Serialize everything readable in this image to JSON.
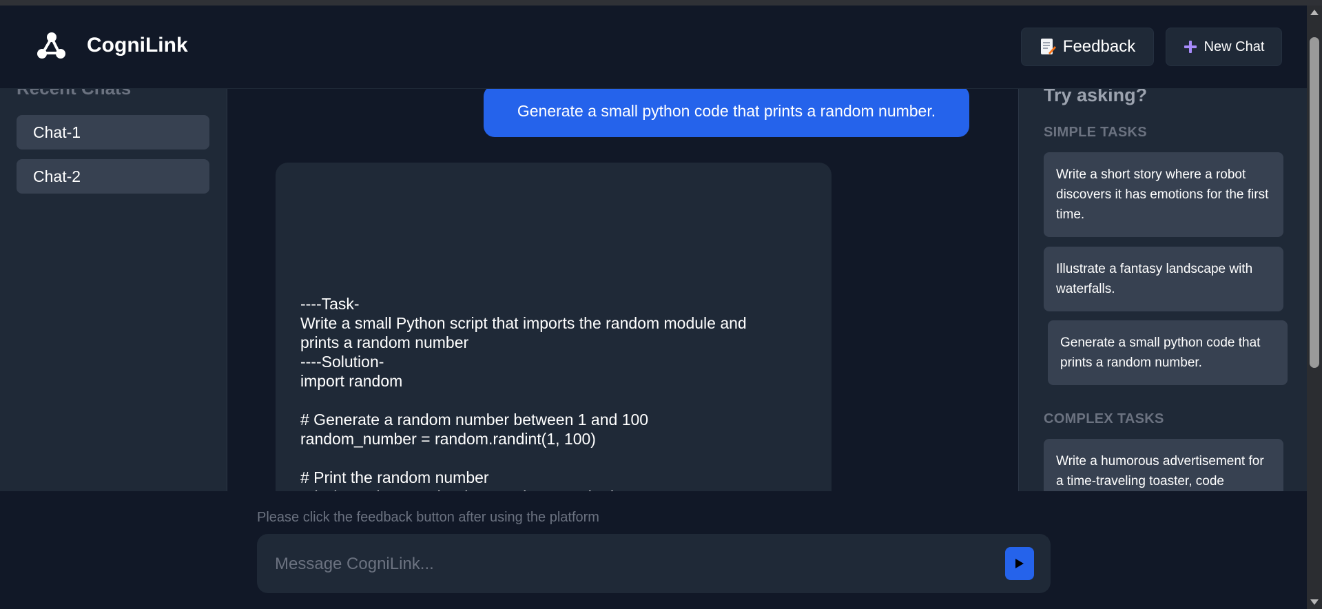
{
  "app": {
    "name": "CogniLink"
  },
  "header": {
    "feedback_label": "Feedback",
    "new_chat_label": "New Chat"
  },
  "sidebar": {
    "title": "Recent Chats",
    "items": [
      {
        "label": "Chat-1"
      },
      {
        "label": "Chat-2"
      }
    ]
  },
  "conversation": {
    "user_message": "Generate a small python code that prints a random number.",
    "bot_message": "----Task-\nWrite a small Python script that imports the random module and\nprints a random number\n----Solution-\nimport random\n\n# Generate a random number between 1 and 100\nrandom_number = random.randint(1, 100)\n\n# Print the random number\nprint(\"Random number is:\", random_number)"
  },
  "suggestions": {
    "title": "Try asking?",
    "simple_label": "SIMPLE TASKS",
    "simple": [
      "Write a short story where a robot discovers it has emotions for the first time.",
      "Illustrate a fantasy landscape with waterfalls.",
      "Generate a small python code that prints a random number."
    ],
    "complex_label": "COMPLEX TASKS",
    "complex": [
      "Write a humorous advertisement for a time-traveling toaster, code"
    ]
  },
  "footer": {
    "note": "Please click the feedback button after using the platform",
    "input_placeholder": "Message CogniLink..."
  },
  "colors": {
    "background": "#111827",
    "panel": "#1f2937",
    "card": "#374151",
    "accent": "#2563eb",
    "muted": "#6b7280"
  },
  "icons": {
    "logo": "network-nodes-icon",
    "feedback": "memo-icon",
    "new_chat": "plus-icon",
    "send": "play-icon"
  }
}
